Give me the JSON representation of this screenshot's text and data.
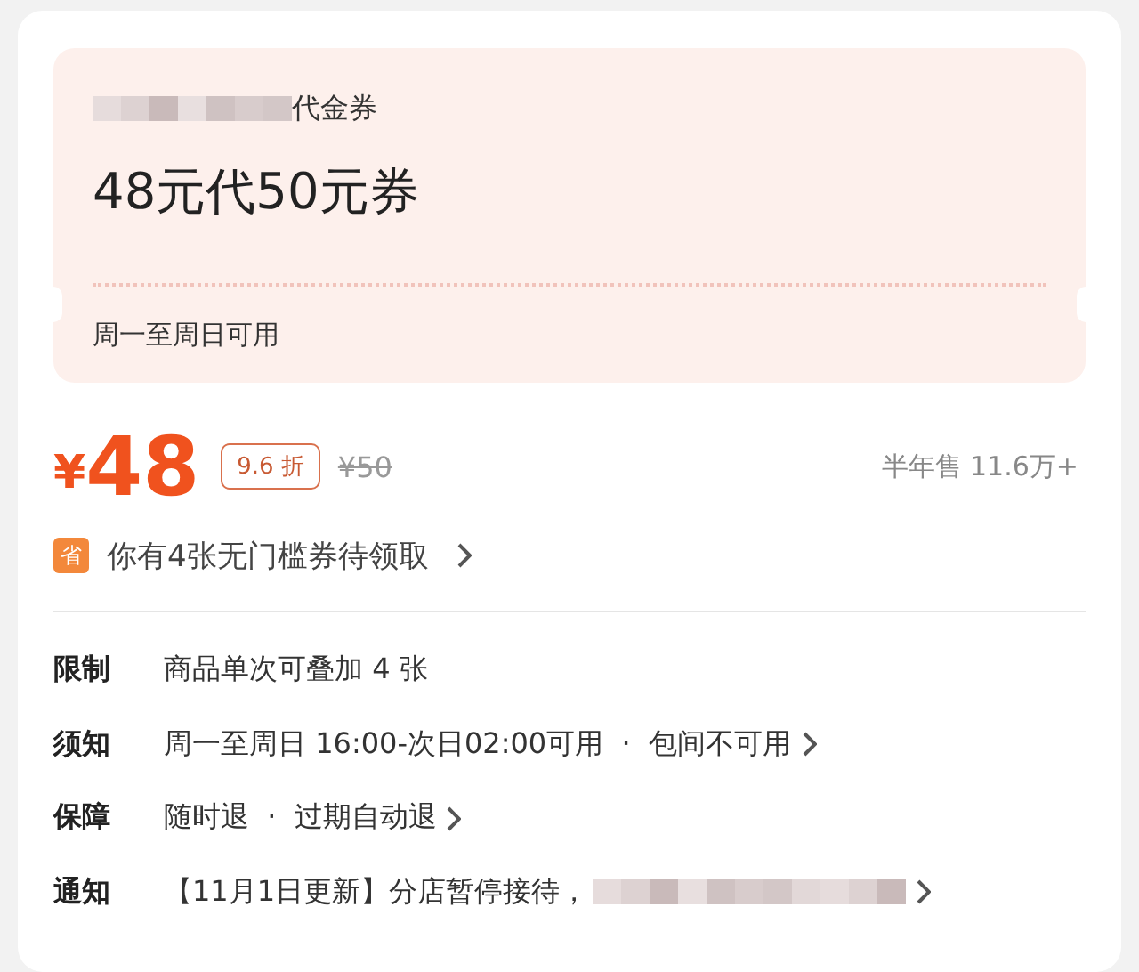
{
  "coupon": {
    "name_suffix": "代金券",
    "title": "48元代50元券",
    "validity": "周一至周日可用"
  },
  "price": {
    "currency": "¥",
    "amount": "48",
    "discount": "9.6 折",
    "original": "¥50",
    "sales": "半年售 11.6万+"
  },
  "promo": {
    "icon_text": "省",
    "text": "你有4张无门槛券待领取"
  },
  "details": [
    {
      "label": "限制",
      "value": "商品单次可叠加 4 张",
      "chevron": false,
      "redacted": false
    },
    {
      "label": "须知",
      "value": "周一至周日 16:00-次日02:00可用  ·  包间不可用",
      "chevron": true,
      "redacted": false
    },
    {
      "label": "保障",
      "value": "随时退  ·  过期自动退",
      "chevron": true,
      "redacted": false
    },
    {
      "label": "通知",
      "value": "【11月1日更新】分店暂停接待，",
      "chevron": true,
      "redacted": true
    }
  ]
}
